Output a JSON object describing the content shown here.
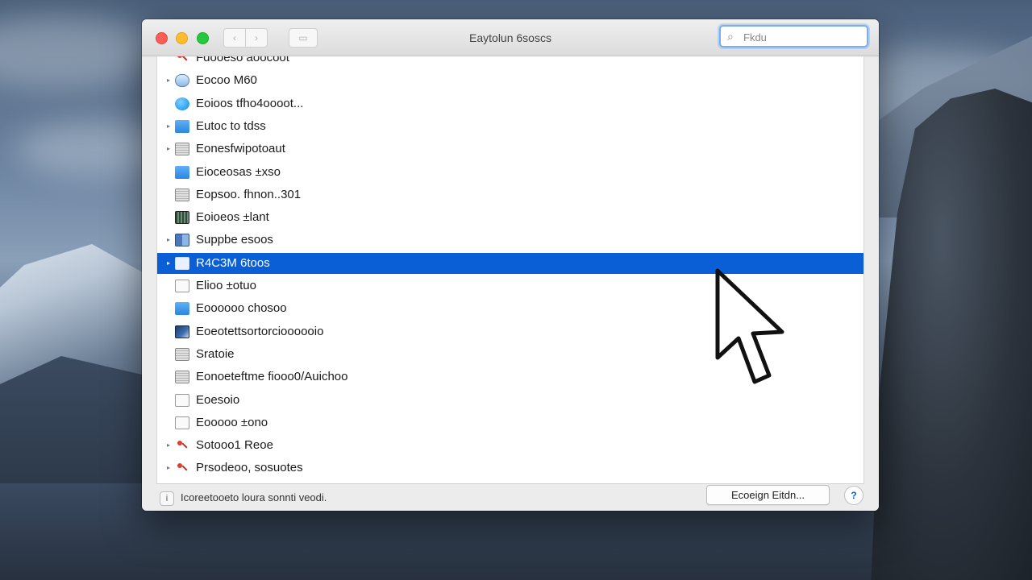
{
  "window": {
    "title": "Eaytolun 6soscs",
    "nav": {
      "back_icon": "‹",
      "forward_icon": "›",
      "view_icon": "▭"
    }
  },
  "search": {
    "placeholder": "Fkdu"
  },
  "list": {
    "rows": [
      {
        "name": "Fdooeso aoocoot",
        "icon": "red-dot-icon",
        "expandable": false,
        "selected": false
      },
      {
        "name": "Eocoo M60",
        "icon": "capsule-icon",
        "expandable": true,
        "selected": false
      },
      {
        "name": "Eoioos tfho4oooot...",
        "icon": "round-blue-icon",
        "expandable": false,
        "selected": false
      },
      {
        "name": "Eutoc to tdss",
        "icon": "blue-folder-icon",
        "expandable": true,
        "selected": false
      },
      {
        "name": "Eonesfwipotoaut",
        "icon": "document-icon",
        "expandable": true,
        "selected": false
      },
      {
        "name": "Eioceosas ±xso",
        "icon": "blue-folder-icon",
        "expandable": false,
        "selected": false
      },
      {
        "name": "Eopsoo. fhnon..301",
        "icon": "grey-document-icon",
        "expandable": false,
        "selected": false
      },
      {
        "name": "Eoioeos ±lant",
        "icon": "image-icon",
        "expandable": false,
        "selected": false
      },
      {
        "name": "Suppbe esoos",
        "icon": "grid-icon",
        "expandable": true,
        "selected": false
      },
      {
        "name": "R4C3M 6toos",
        "icon": "file-icon",
        "expandable": true,
        "selected": true
      },
      {
        "name": "Elioo ±otuo",
        "icon": "pencil-document-icon",
        "expandable": false,
        "selected": false
      },
      {
        "name": "Eoooooo chosoo",
        "icon": "blue-folder-icon",
        "expandable": false,
        "selected": false
      },
      {
        "name": "Eoeotettsortorcioooooio",
        "icon": "chart-icon",
        "expandable": false,
        "selected": false
      },
      {
        "name": "Sratoie",
        "icon": "document-icon",
        "expandable": false,
        "selected": false
      },
      {
        "name": "Eonoeteftme fiooo0/Auichoo",
        "icon": "grey-document-icon",
        "expandable": false,
        "selected": false
      },
      {
        "name": "Eoesoio",
        "icon": "blank-document-icon",
        "expandable": false,
        "selected": false
      },
      {
        "name": "Eooooo ±ono",
        "icon": "blank-document-icon",
        "expandable": false,
        "selected": false
      },
      {
        "name": "Sotooo1 Reoe",
        "icon": "red-tool-icon",
        "expandable": true,
        "selected": false
      },
      {
        "name": "Prsodeoo, sosuotes",
        "icon": "red-tool-icon",
        "expandable": true,
        "selected": false
      }
    ]
  },
  "bottom": {
    "info_icon": "i",
    "status": "Icoreetooeto loura sonnti veodi.",
    "action_label": "Ecoeign Eitdn...",
    "help_icon": "?"
  },
  "colors": {
    "selection": "#0b5fd6",
    "close": "#fd5f57",
    "minimize": "#fdbd2e",
    "zoom": "#27c840",
    "search_focus": "#7aaef0"
  }
}
